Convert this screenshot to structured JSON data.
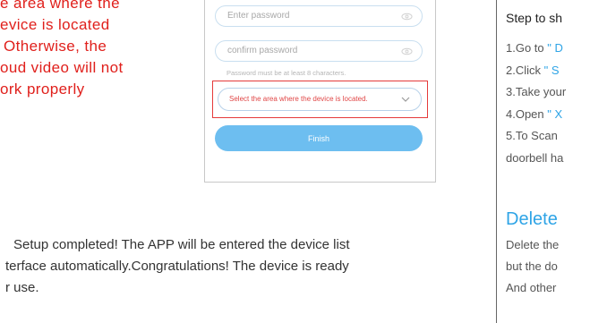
{
  "left_note": {
    "lines": [
      "e area where the",
      "evice is located",
      "Otherwise, the",
      "oud video will not",
      "ork properly"
    ]
  },
  "phone": {
    "fields": [
      {
        "placeholder": "Enter password"
      },
      {
        "placeholder": "confirm password"
      }
    ],
    "hint": "Password must be at least 8 characters.",
    "area_select": "Select the area where the device is located.",
    "finish_label": "Finish",
    "colors": {
      "accent": "#6dbef0",
      "highlight_border": "#e53a3a"
    }
  },
  "setup_text": {
    "lines": [
      "Setup completed! The APP will be entered the device list",
      "terface automatically.Congratulations! The device is ready",
      "r use."
    ]
  },
  "right_panel": {
    "title": "Step to sh",
    "steps": [
      {
        "prefix": "1.Go to ",
        "highlight": "\" D"
      },
      {
        "prefix": "2.Click ",
        "highlight": "\" S"
      },
      {
        "prefix": "3.Take your",
        "highlight": ""
      },
      {
        "prefix": "4.Open ",
        "highlight": "\" X"
      },
      {
        "prefix": "5.To Scan ",
        "highlight": ""
      },
      {
        "prefix": "doorbell ha",
        "highlight": ""
      }
    ],
    "delete_title": "Delete",
    "delete_lines": [
      "Delete the",
      "but the do",
      "And other"
    ]
  }
}
